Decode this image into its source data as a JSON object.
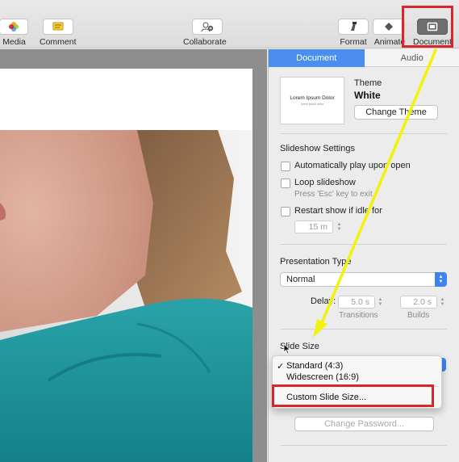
{
  "toolbar": {
    "media_label": "Media",
    "comment_label": "Comment",
    "collaborate_label": "Collaborate",
    "format_label": "Format",
    "animate_label": "Animate",
    "document_label": "Document"
  },
  "inspector": {
    "tabs": [
      {
        "label": "Document",
        "active": true
      },
      {
        "label": "Audio",
        "active": false
      }
    ],
    "theme": {
      "thumbnail_title": "Lorem Ipsum Dolor",
      "thumbnail_subtitle": "lorem ipsum dolor",
      "heading": "Theme",
      "name": "White",
      "change_button": "Change Theme"
    },
    "slideshow": {
      "heading": "Slideshow Settings",
      "autoplay_label": "Automatically play upon open",
      "loop_label": "Loop slideshow",
      "loop_hint": "Press 'Esc' key to exit",
      "restart_label": "Restart show if idle for",
      "idle_value": "15 m"
    },
    "presentation": {
      "heading": "Presentation Type",
      "type_value": "Normal",
      "delay_label": "Delay:",
      "transitions_value": "5.0 s",
      "transitions_label": "Transitions",
      "builds_value": "2.0 s",
      "builds_label": "Builds"
    },
    "slide_size": {
      "heading": "Slide Size",
      "options": [
        "Standard (4:3)",
        "Widescreen (16:9)"
      ],
      "selected": "Standard (4:3)",
      "custom_option": "Custom Slide Size...",
      "password_button": "Change Password..."
    }
  },
  "colors": {
    "accent": "#4a8ff0",
    "annotation_red": "#d8262c",
    "annotation_arrow": "#f2f20a"
  }
}
